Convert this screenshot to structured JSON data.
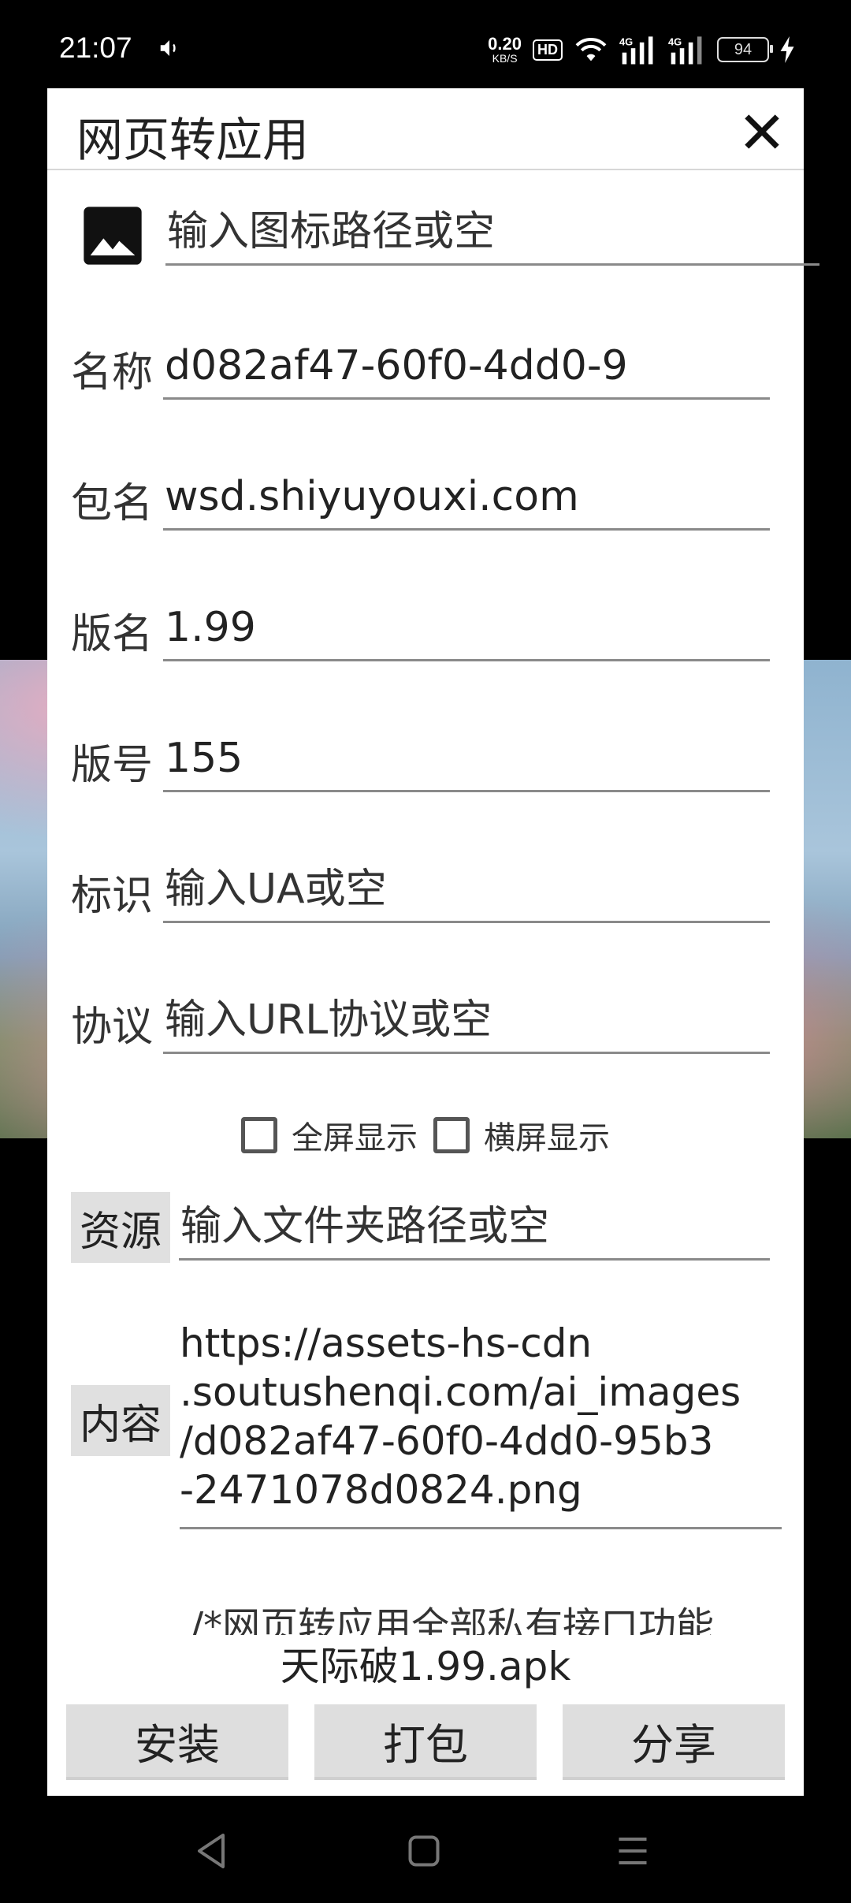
{
  "status_bar": {
    "time": "21:07",
    "speed_value": "0.20",
    "speed_unit": "KB/S",
    "hd": "HD",
    "battery": "94",
    "icons": [
      "sound-icon",
      "wifi-icon",
      "signal-4g-icon",
      "signal-4g-icon",
      "charging-icon"
    ]
  },
  "dialog": {
    "title": "网页转应用",
    "icon_path": {
      "placeholder": "输入图标路径或空"
    },
    "fields": {
      "name": {
        "label": "名称",
        "value": "d082af47-60f0-4dd0-9"
      },
      "package": {
        "label": "包名",
        "value": "wsd.shiyuyouxi.com"
      },
      "version_name": {
        "label": "版名",
        "value": "1.99"
      },
      "version_code": {
        "label": "版号",
        "value": "155"
      },
      "ua": {
        "label": "标识",
        "placeholder": "输入UA或空"
      },
      "protocol": {
        "label": "协议",
        "placeholder": "输入URL协议或空"
      }
    },
    "checkboxes": {
      "fullscreen": "全屏显示",
      "landscape": "横屏显示"
    },
    "resources": {
      "button": "资源",
      "placeholder": "输入文件夹路径或空"
    },
    "content": {
      "button": "内容",
      "lines": [
        "https://assets-hs-cdn",
        ".soutushenqi.com/ai_images",
        "/d082af47-60f0-4dd0-95b3",
        "-2471078d0824.png"
      ]
    },
    "comment": "/*网页转应用全部私有接口功能",
    "apk_name": "天际破1.99.apk",
    "actions": {
      "install": "安装",
      "package": "打包",
      "share": "分享"
    }
  },
  "nav_bar": {
    "icons": [
      "back-icon",
      "home-icon",
      "recents-icon"
    ]
  }
}
